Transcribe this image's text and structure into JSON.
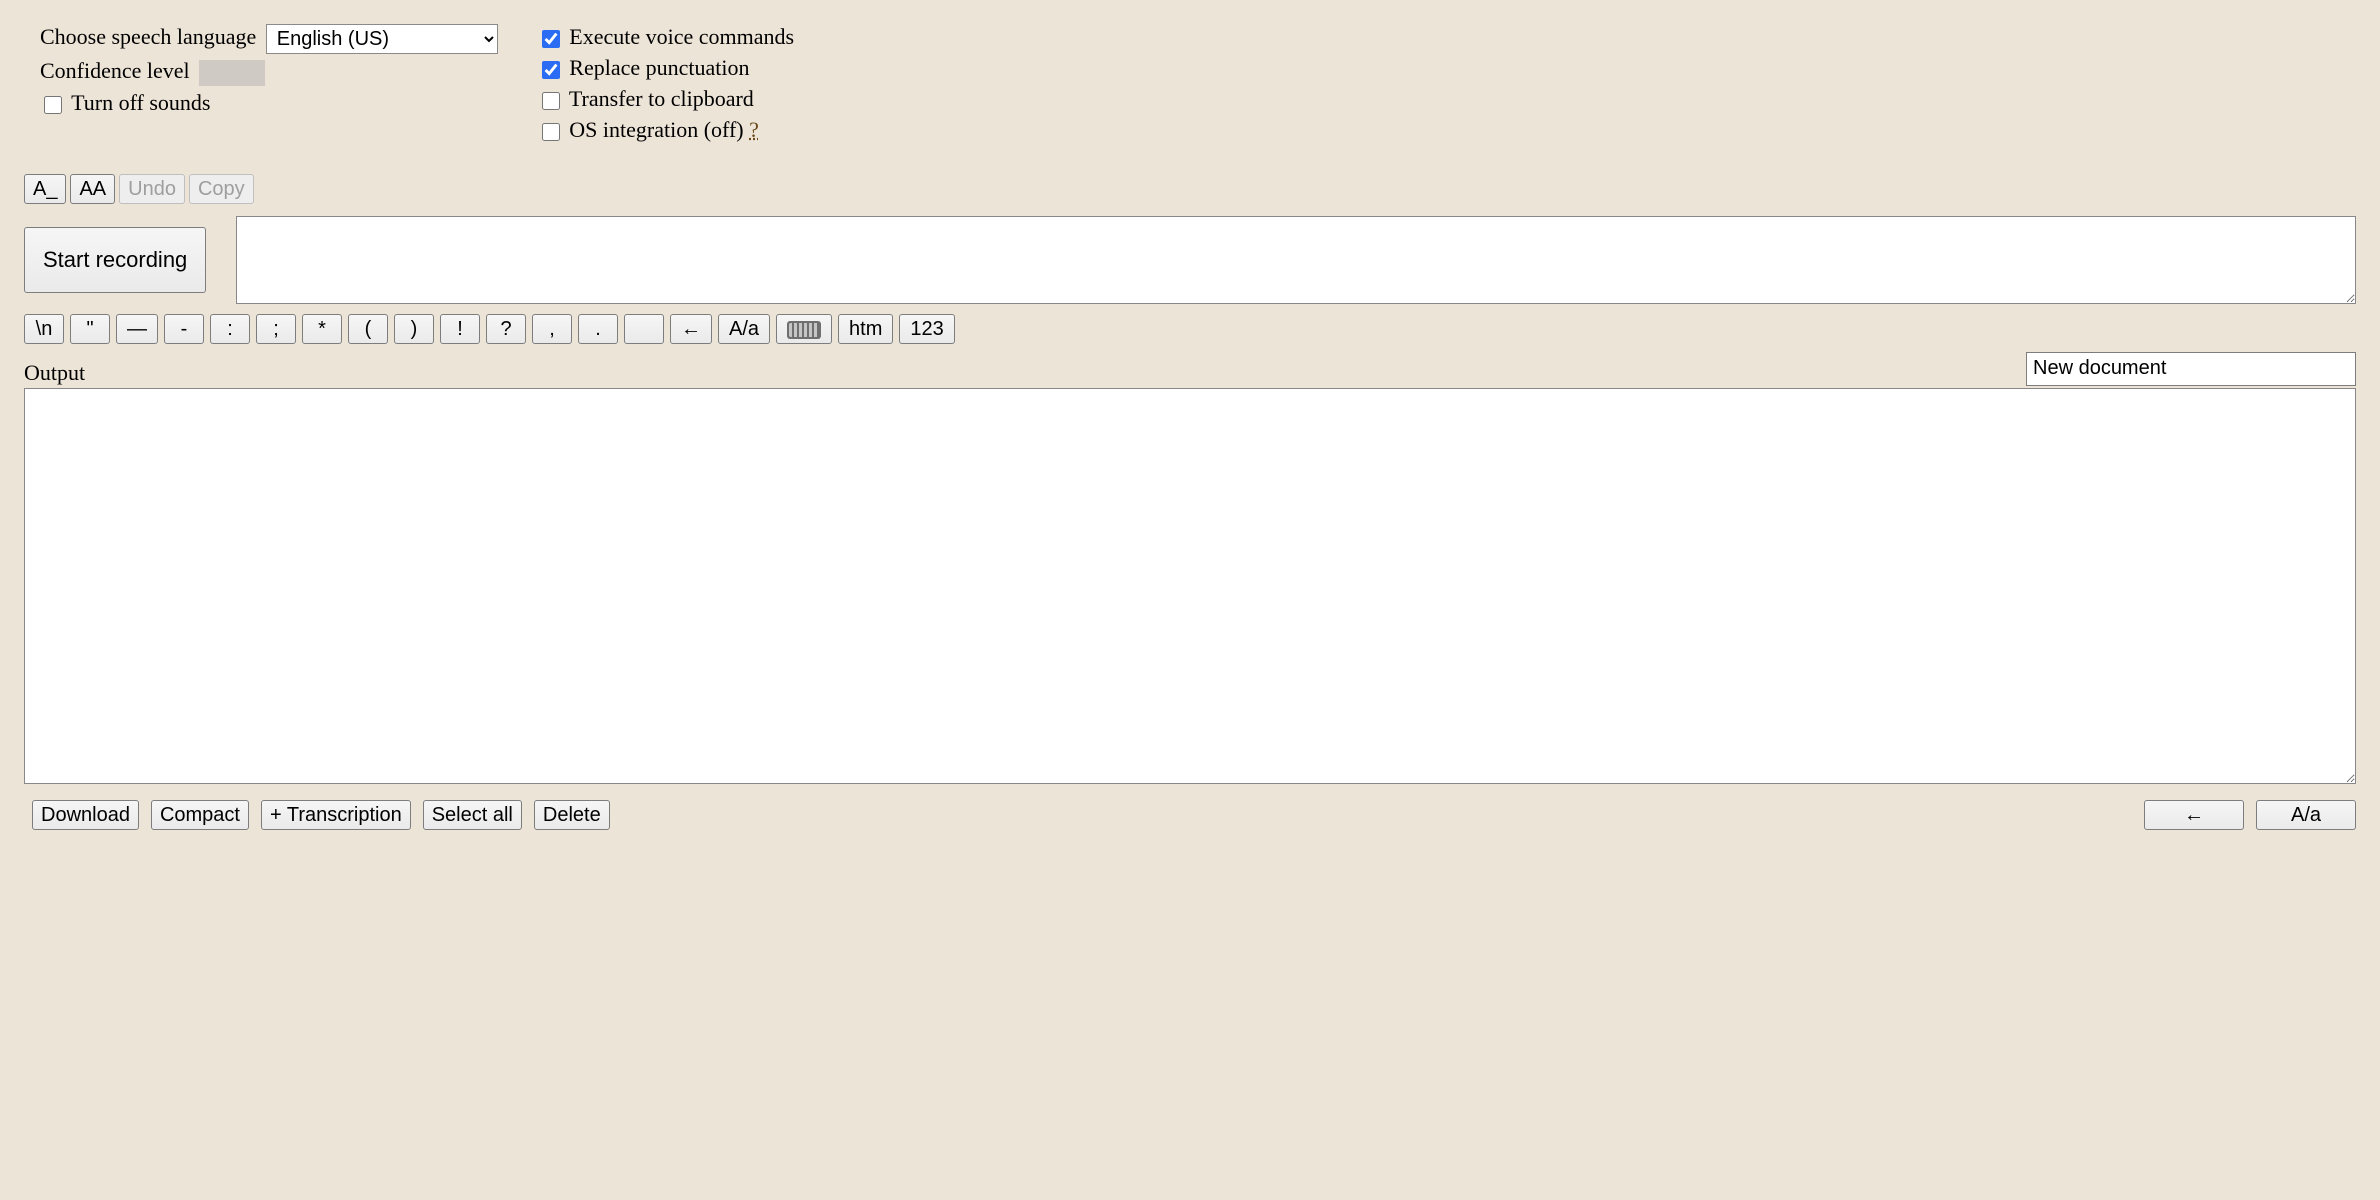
{
  "settings": {
    "language_label": "Choose speech language",
    "language_value": "English (US)",
    "confidence_label": "Confidence level",
    "confidence_value": "",
    "turn_off_sounds": {
      "label": "Turn off sounds",
      "checked": false
    },
    "execute_voice_commands": {
      "label": "Execute voice commands",
      "checked": true
    },
    "replace_punctuation": {
      "label": "Replace punctuation",
      "checked": true
    },
    "transfer_to_clipboard": {
      "label": "Transfer to clipboard",
      "checked": false
    },
    "os_integration": {
      "label": "OS integration (off)",
      "checked": false,
      "help": "?"
    }
  },
  "mini_toolbar": {
    "a_small": "A_",
    "a_large": "AA",
    "undo": "Undo",
    "copy": "Copy"
  },
  "record": {
    "button": "Start recording",
    "transcription_value": ""
  },
  "punct": {
    "items": [
      "\\n",
      "\"",
      "—",
      "-",
      ":",
      ";",
      "*",
      "(",
      ")",
      "!",
      "?",
      ",",
      ".",
      "",
      "←",
      "A/a"
    ],
    "htm": "htm",
    "num": "123"
  },
  "output": {
    "label": "Output",
    "doc_name": "New document",
    "value": ""
  },
  "bottom": {
    "download": "Download",
    "compact": "Compact",
    "plus_transcription": "+ Transcription",
    "select_all": "Select all",
    "delete": "Delete",
    "back": "←",
    "case_toggle": "A/a"
  }
}
